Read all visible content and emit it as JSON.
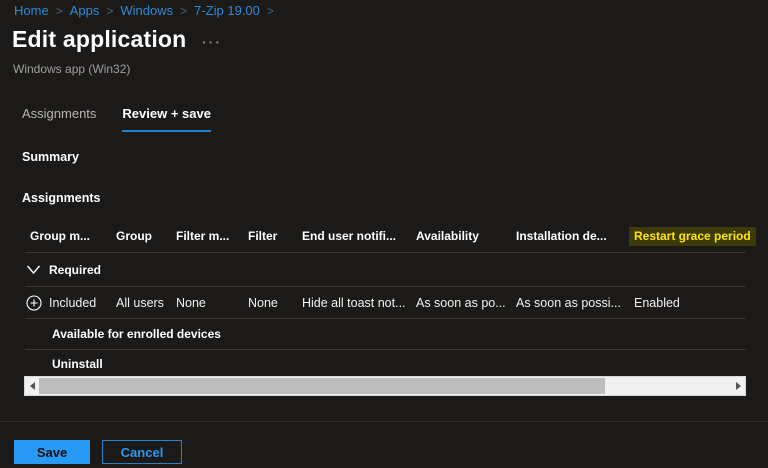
{
  "breadcrumb": {
    "separator": ">",
    "items": [
      "Home",
      "Apps",
      "Windows",
      "7-Zip 19.00"
    ]
  },
  "header": {
    "title": "Edit application",
    "more_label": "···",
    "subtitle": "Windows app (Win32)"
  },
  "tabs": [
    {
      "label": "Assignments",
      "active": false
    },
    {
      "label": "Review + save",
      "active": true
    }
  ],
  "sections": {
    "summary_heading": "Summary",
    "assignments_heading": "Assignments"
  },
  "table": {
    "columns": [
      "Group m...",
      "Group",
      "Filter m...",
      "Filter",
      "End user notifi...",
      "Availability",
      "Installation de...",
      "Restart grace period"
    ],
    "highlighted_column": "Restart grace period",
    "groups": {
      "required": {
        "label": "Required",
        "expanded": true
      },
      "available": {
        "label": "Available for enrolled devices"
      },
      "uninstall": {
        "label": "Uninstall"
      }
    },
    "row": {
      "group_mode": "Included",
      "group": "All users",
      "filter_mode": "None",
      "filter": "None",
      "end_user_notification": "Hide all toast not...",
      "availability": "As soon as po...",
      "installation_deadline": "As soon as possi...",
      "restart_grace_period": "Enabled"
    }
  },
  "icons": {
    "chevron_down": "chevron-down-icon",
    "add_circle": "add-circle-icon",
    "scroll_left": "scroll-left-arrow-icon",
    "scroll_right": "scroll-right-arrow-icon"
  },
  "footer": {
    "save_label": "Save",
    "cancel_label": "Cancel"
  },
  "colors": {
    "background": "#1b1a19",
    "link_blue": "#2e8ad8",
    "accent_blue": "#2899f5",
    "tab_underline": "#1a80d8",
    "highlight_text": "#ffe600",
    "highlight_bg": "#3c3a06",
    "divider": "#383736"
  }
}
